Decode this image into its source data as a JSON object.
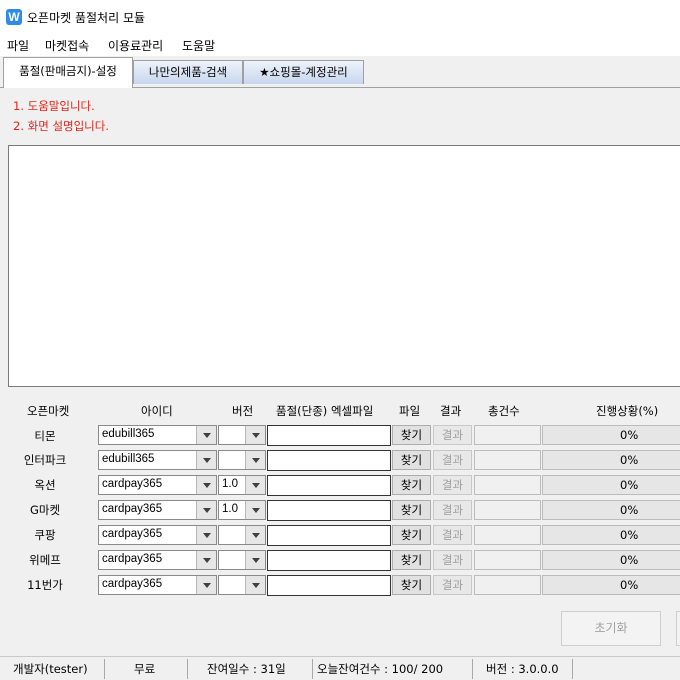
{
  "window": {
    "icon": "W",
    "title": "오픈마켓 품절처리 모듈"
  },
  "menu": [
    "파일",
    "마켓접속",
    "이용료관리",
    "도움말"
  ],
  "tabs": [
    "품절(판매금지)-설정",
    "나만의제품-검색",
    "★쇼핑몰-계정관리"
  ],
  "help": [
    "1. 도움말입니다.",
    "2. 화면 설명입니다."
  ],
  "columns": {
    "market": "오픈마켓",
    "id": "아이디",
    "version": "버전",
    "file": "품절(단종) 엑셀파일",
    "find": "파일",
    "result": "결과",
    "total": "총건수",
    "progress": "진행상황(%)"
  },
  "rows": [
    {
      "market": "티몬",
      "id": "edubill365",
      "version": "",
      "find": "찾기",
      "result": "결과",
      "progress_pct": 0,
      "progress_text": "0%"
    },
    {
      "market": "인터파크",
      "id": "edubill365",
      "version": "",
      "find": "찾기",
      "result": "결과",
      "progress_pct": 0,
      "progress_text": "0%"
    },
    {
      "market": "옥션",
      "id": "cardpay365",
      "version": "1.0",
      "find": "찾기",
      "result": "결과",
      "progress_pct": 0,
      "progress_text": "0%"
    },
    {
      "market": "G마켓",
      "id": "cardpay365",
      "version": "1.0",
      "find": "찾기",
      "result": "결과",
      "progress_pct": 0,
      "progress_text": "0%"
    },
    {
      "market": "쿠팡",
      "id": "cardpay365",
      "version": "",
      "find": "찾기",
      "result": "결과",
      "progress_pct": 0,
      "progress_text": "0%"
    },
    {
      "market": "위메프",
      "id": "cardpay365",
      "version": "",
      "find": "찾기",
      "result": "결과",
      "progress_pct": 0,
      "progress_text": "0%"
    },
    {
      "market": "11번가",
      "id": "cardpay365",
      "version": "",
      "find": "찾기",
      "result": "결과",
      "progress_pct": 0,
      "progress_text": "0%"
    }
  ],
  "buttons": {
    "reset": "초기화"
  },
  "status": {
    "user": "개발자(tester)",
    "plan": "무료",
    "days_left": "잔여일수 : 31일",
    "today_left": "오늘잔여건수 : 100/ 200",
    "version": "버전 : 3.0.0.0"
  },
  "colors": {
    "help_text": "#e0271d",
    "tab_inactive": "#c8d6ee",
    "progress_fill": "#06b025"
  },
  "icons": {
    "app": "app-logo-icon",
    "dropdown": "chevron-down-icon"
  }
}
